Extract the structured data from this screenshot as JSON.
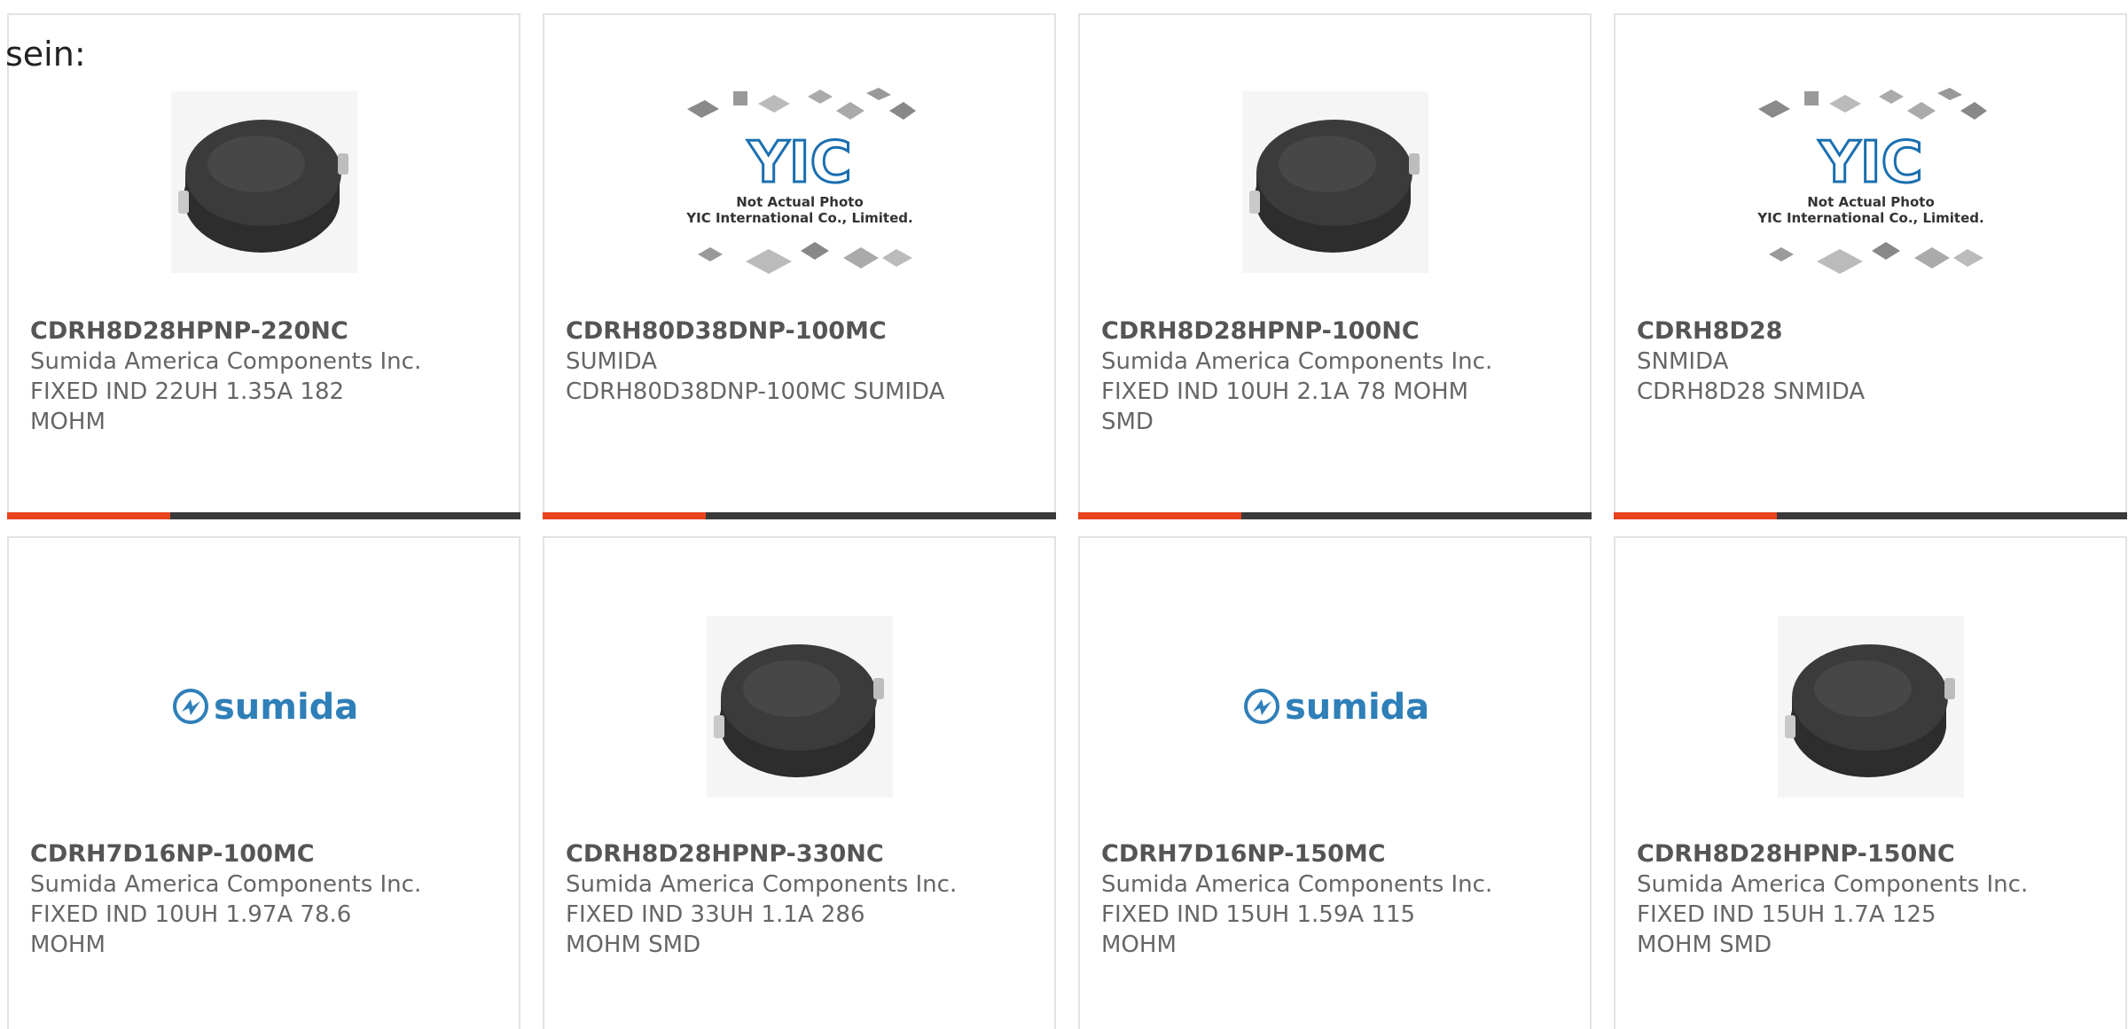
{
  "intro_label": "sein:",
  "colors": {
    "accent": "#e8421f",
    "bar": "#3a3a3a",
    "card_border": "#e3e3e3",
    "sumida_blue": "#2f7fb8"
  },
  "products": [
    {
      "part_number": "CDRH8D28HPNP-220NC",
      "manufacturer": "Sumida America Components Inc.",
      "description": "FIXED IND 22UH 1.35A 182 MOHM",
      "image": "inductor-photo",
      "show_bar": true
    },
    {
      "part_number": "CDRH80D38DNP-100MC",
      "manufacturer": "SUMIDA",
      "description": "CDRH80D38DNP-100MC SUMIDA",
      "image": "yic-placeholder",
      "placeholder_line1": "Not Actual Photo",
      "placeholder_line2": "YIC International Co., Limited.",
      "show_bar": true
    },
    {
      "part_number": "CDRH8D28HPNP-100NC",
      "manufacturer": "Sumida America Components Inc.",
      "description": "FIXED IND 10UH 2.1A 78 MOHM SMD",
      "image": "inductor-photo",
      "show_bar": true
    },
    {
      "part_number": "CDRH8D28",
      "manufacturer": "SNMIDA",
      "description": "CDRH8D28 SNMIDA",
      "image": "yic-placeholder",
      "placeholder_line1": "Not Actual Photo",
      "placeholder_line2": "YIC International Co., Limited.",
      "show_bar": true
    },
    {
      "part_number": "CDRH7D16NP-100MC",
      "manufacturer": "Sumida America Components Inc.",
      "description": "FIXED IND 10UH 1.97A 78.6 MOHM",
      "image": "sumida-logo",
      "logo_text": "sumida",
      "show_bar": false
    },
    {
      "part_number": "CDRH8D28HPNP-330NC",
      "manufacturer": "Sumida America Components Inc.",
      "description": "FIXED IND 33UH 1.1A 286 MOHM SMD",
      "image": "inductor-photo",
      "show_bar": false
    },
    {
      "part_number": "CDRH7D16NP-150MC",
      "manufacturer": "Sumida America Components Inc.",
      "description": "FIXED IND 15UH 1.59A 115 MOHM",
      "image": "sumida-logo",
      "logo_text": "sumida",
      "show_bar": false
    },
    {
      "part_number": "CDRH8D28HPNP-150NC",
      "manufacturer": "Sumida America Components Inc.",
      "description": "FIXED IND 15UH 1.7A 125 MOHM SMD",
      "image": "inductor-photo",
      "show_bar": false
    }
  ]
}
